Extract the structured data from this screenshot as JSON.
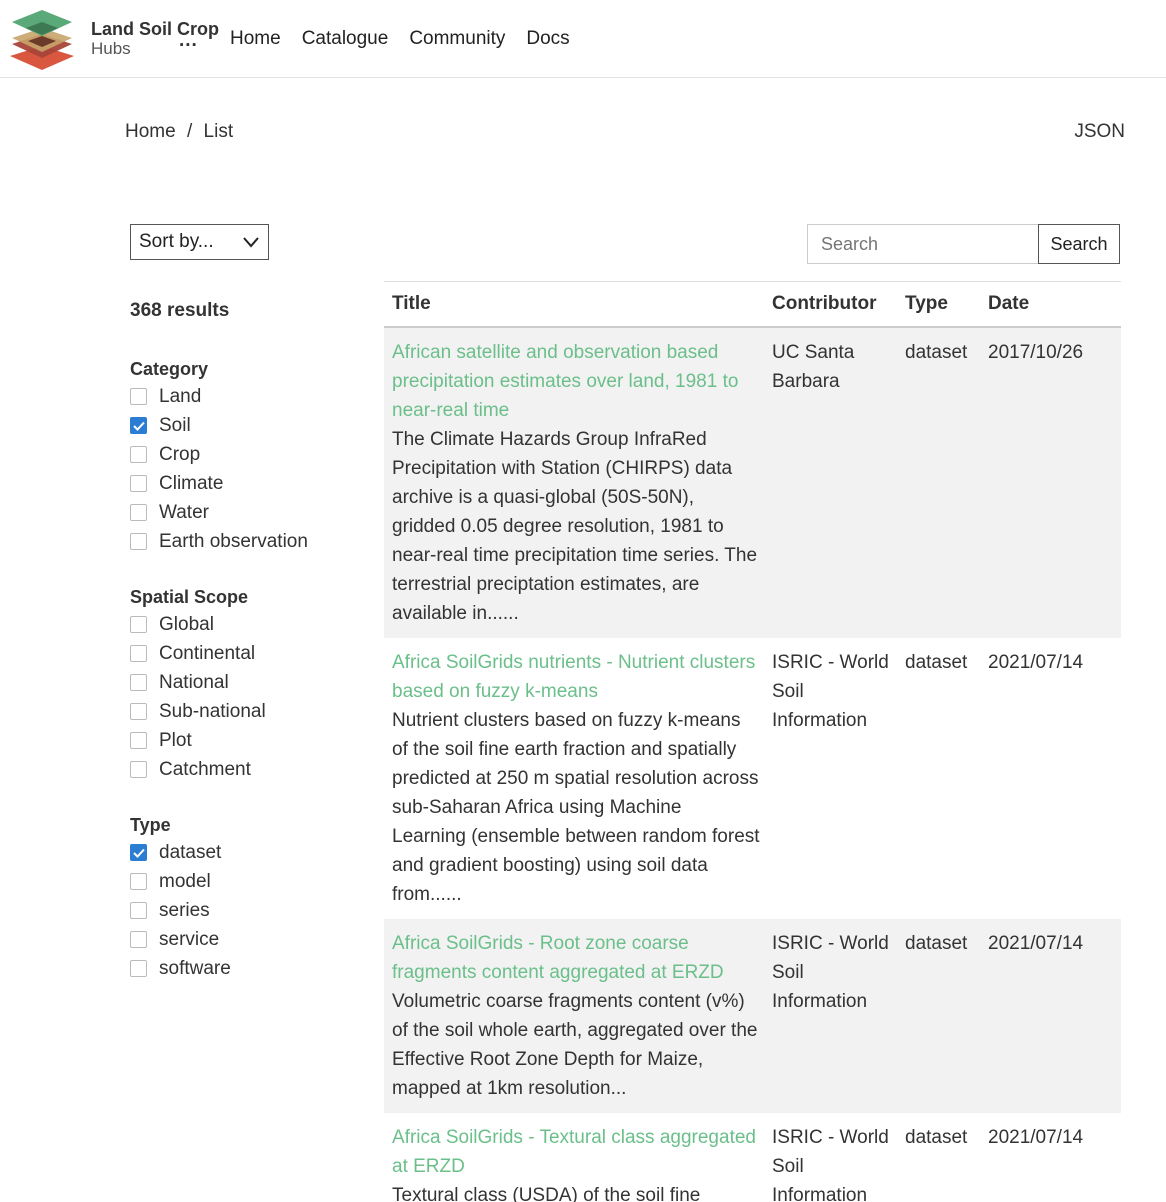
{
  "brand": {
    "title": "Land Soil Crop",
    "subtitle": "Hubs",
    "dots": "...",
    "colors": {
      "green": "#5aa979",
      "tan": "#c8a46a",
      "red": "#d9563f"
    }
  },
  "nav": {
    "items": [
      "Home",
      "Catalogue",
      "Community",
      "Docs"
    ]
  },
  "breadcrumb": {
    "home": "Home",
    "separator": "/",
    "current": "List"
  },
  "json_link": "JSON",
  "sort": {
    "label": "Sort by..."
  },
  "search": {
    "placeholder": "Search",
    "button": "Search"
  },
  "results": {
    "count_label": "368 results"
  },
  "facets": [
    {
      "title": "Category",
      "items": [
        {
          "label": "Land",
          "checked": false
        },
        {
          "label": "Soil",
          "checked": true
        },
        {
          "label": "Crop",
          "checked": false
        },
        {
          "label": "Climate",
          "checked": false
        },
        {
          "label": "Water",
          "checked": false
        },
        {
          "label": "Earth observation",
          "checked": false
        }
      ]
    },
    {
      "title": "Spatial Scope",
      "items": [
        {
          "label": "Global",
          "checked": false
        },
        {
          "label": "Continental",
          "checked": false
        },
        {
          "label": "National",
          "checked": false
        },
        {
          "label": "Sub-national",
          "checked": false
        },
        {
          "label": "Plot",
          "checked": false
        },
        {
          "label": "Catchment",
          "checked": false
        }
      ]
    },
    {
      "title": "Type",
      "items": [
        {
          "label": "dataset",
          "checked": true
        },
        {
          "label": "model",
          "checked": false
        },
        {
          "label": "series",
          "checked": false
        },
        {
          "label": "service",
          "checked": false
        },
        {
          "label": "software",
          "checked": false
        }
      ]
    }
  ],
  "table": {
    "headers": {
      "title": "Title",
      "contributor": "Contributor",
      "type": "Type",
      "date": "Date"
    },
    "rows": [
      {
        "title": "African satellite and observation based precipitation estimates over land, 1981 to near-real time",
        "description": "The Climate Hazards Group InfraRed Precipitation with Station (CHIRPS) data archive is a quasi-global (50S-50N), gridded 0.05 degree resolution, 1981 to near-real time precipitation time series. The terrestrial preciptation estimates, are available in......",
        "contributor": "UC Santa Barbara",
        "type": "dataset",
        "date": "2017/10/26"
      },
      {
        "title": "Africa SoilGrids nutrients - Nutrient clusters based on fuzzy k-means",
        "description": "Nutrient clusters based on fuzzy k-means of the soil fine earth fraction and spatially predicted at 250 m spatial resolution across sub-Saharan Africa using Machine Learning (ensemble between random forest and gradient boosting) using soil data from......",
        "contributor": "ISRIC - World Soil Information",
        "type": "dataset",
        "date": "2021/07/14"
      },
      {
        "title": "Africa SoilGrids - Root zone coarse fragments content aggregated at ERZD",
        "description": "Volumetric coarse fragments content (v%) of the soil whole earth, aggregated over the Effective Root Zone Depth for Maize, mapped at 1km resolution...",
        "contributor": "ISRIC - World Soil Information",
        "type": "dataset",
        "date": "2021/07/14"
      },
      {
        "title": "Africa SoilGrids - Textural class aggregated at ERZD",
        "description": "Textural class (USDA) of the soil fine",
        "contributor": "ISRIC - World Soil Information",
        "type": "dataset",
        "date": "2021/07/14"
      }
    ]
  }
}
